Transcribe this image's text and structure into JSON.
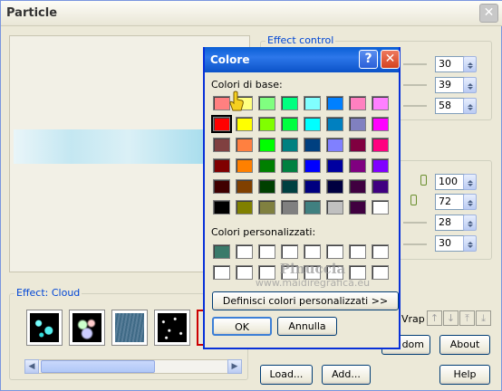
{
  "main": {
    "title": "Particle",
    "effect_control_label": "Effect control",
    "effect_label": "Effect: Cloud",
    "spin_values_top": [
      "30",
      "39",
      "58"
    ],
    "spin_values_bottom": [
      "100",
      "72",
      "28",
      "30"
    ],
    "wrap_label": "Vrap",
    "buttons": {
      "random": "dom",
      "about": "About",
      "load": "Load...",
      "add": "Add...",
      "help": "Help"
    },
    "arrow_icons": [
      "up-arrow-icon",
      "down-arrow-icon",
      "top-arrow-icon",
      "bottom-arrow-icon"
    ],
    "thumbnails": [
      "bubbles",
      "sparkles",
      "rain",
      "stars"
    ]
  },
  "dialog": {
    "title": "Colore",
    "help_glyph": "?",
    "basic_colors_label": "Colori di base:",
    "custom_colors_label": "Colori personalizzati:",
    "define_button": "Definisci colori personalizzati >>",
    "ok_button": "OK",
    "cancel_button": "Annulla",
    "basic_colors": [
      [
        "#ff8080",
        "#ffff80",
        "#80ff80",
        "#00ff80",
        "#80ffff",
        "#0080ff",
        "#ff80c0",
        "#ff80ff"
      ],
      [
        "#ff0000",
        "#ffff00",
        "#80ff00",
        "#00ff40",
        "#00ffff",
        "#0080c0",
        "#8080c0",
        "#ff00ff"
      ],
      [
        "#804040",
        "#ff8040",
        "#00ff00",
        "#008080",
        "#004080",
        "#8080ff",
        "#800040",
        "#ff0080"
      ],
      [
        "#800000",
        "#ff8000",
        "#008000",
        "#008040",
        "#0000ff",
        "#0000a0",
        "#800080",
        "#8000ff"
      ],
      [
        "#400000",
        "#804000",
        "#004000",
        "#004040",
        "#000080",
        "#000040",
        "#400040",
        "#400080"
      ],
      [
        "#000000",
        "#808000",
        "#808040",
        "#808080",
        "#408080",
        "#c0c0c0",
        "#400040",
        "#ffffff"
      ]
    ],
    "custom_colors": [
      [
        "#3a7a6a",
        "#ffffff",
        "#ffffff",
        "#ffffff",
        "#ffffff",
        "#ffffff",
        "#ffffff",
        "#ffffff"
      ],
      [
        "#ffffff",
        "#ffffff",
        "#ffffff",
        "#ffffff",
        "#ffffff",
        "#ffffff",
        "#ffffff",
        "#ffffff"
      ]
    ],
    "selected_color": "#ff0000"
  },
  "watermark": {
    "line1": "Pinuccia",
    "line2": "www.maidiregrafica.eu"
  },
  "colors": {
    "accent_blue": "#0831d9",
    "close_red": "#e0533b"
  }
}
